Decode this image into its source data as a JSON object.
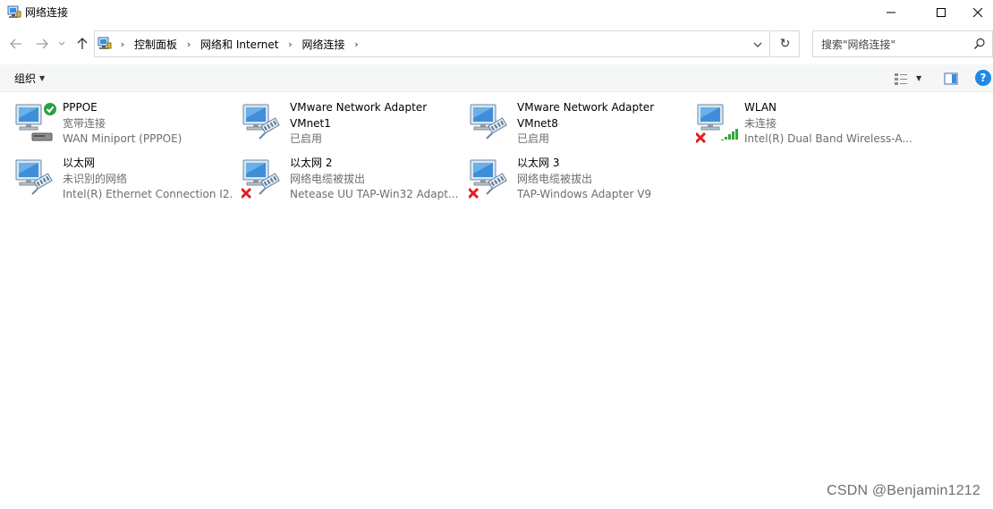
{
  "window": {
    "title": "网络连接"
  },
  "address": {
    "crumbs": [
      "控制面板",
      "网络和 Internet",
      "网络连接"
    ]
  },
  "search": {
    "placeholder": "搜索\"网络连接\""
  },
  "toolbar": {
    "organize_label": "组织",
    "help_label": "?"
  },
  "connections": [
    {
      "name": "PPPOE",
      "status": "宽带连接",
      "device": "WAN Miniport (PPPOE)",
      "overlay": "check",
      "kind": "dialup"
    },
    {
      "name": "VMware Network Adapter",
      "name2": "VMnet1",
      "status": "已启用",
      "device": "",
      "overlay": "",
      "kind": "ethernet"
    },
    {
      "name": "VMware Network Adapter",
      "name2": "VMnet8",
      "status": "已启用",
      "device": "",
      "overlay": "",
      "kind": "ethernet"
    },
    {
      "name": "WLAN",
      "status": "未连接",
      "device": "Intel(R) Dual Band Wireless-A...",
      "overlay": "x",
      "kind": "wifi"
    },
    {
      "name": "以太网",
      "status": "未识别的网络",
      "device": "Intel(R) Ethernet Connection I2...",
      "overlay": "",
      "kind": "ethernet"
    },
    {
      "name": "以太网 2",
      "status": "网络电缆被拔出",
      "device": "Netease UU TAP-Win32 Adapt...",
      "overlay": "x",
      "kind": "ethernet"
    },
    {
      "name": "以太网 3",
      "status": "网络电缆被拔出",
      "device": "TAP-Windows Adapter V9",
      "overlay": "x",
      "kind": "ethernet"
    }
  ],
  "watermark": "CSDN @Benjamin1212",
  "colors": {
    "accent": "#1e88e5",
    "secondary_text": "#6d6d6d",
    "error_red": "#e02020",
    "ok_green": "#2ea043"
  }
}
